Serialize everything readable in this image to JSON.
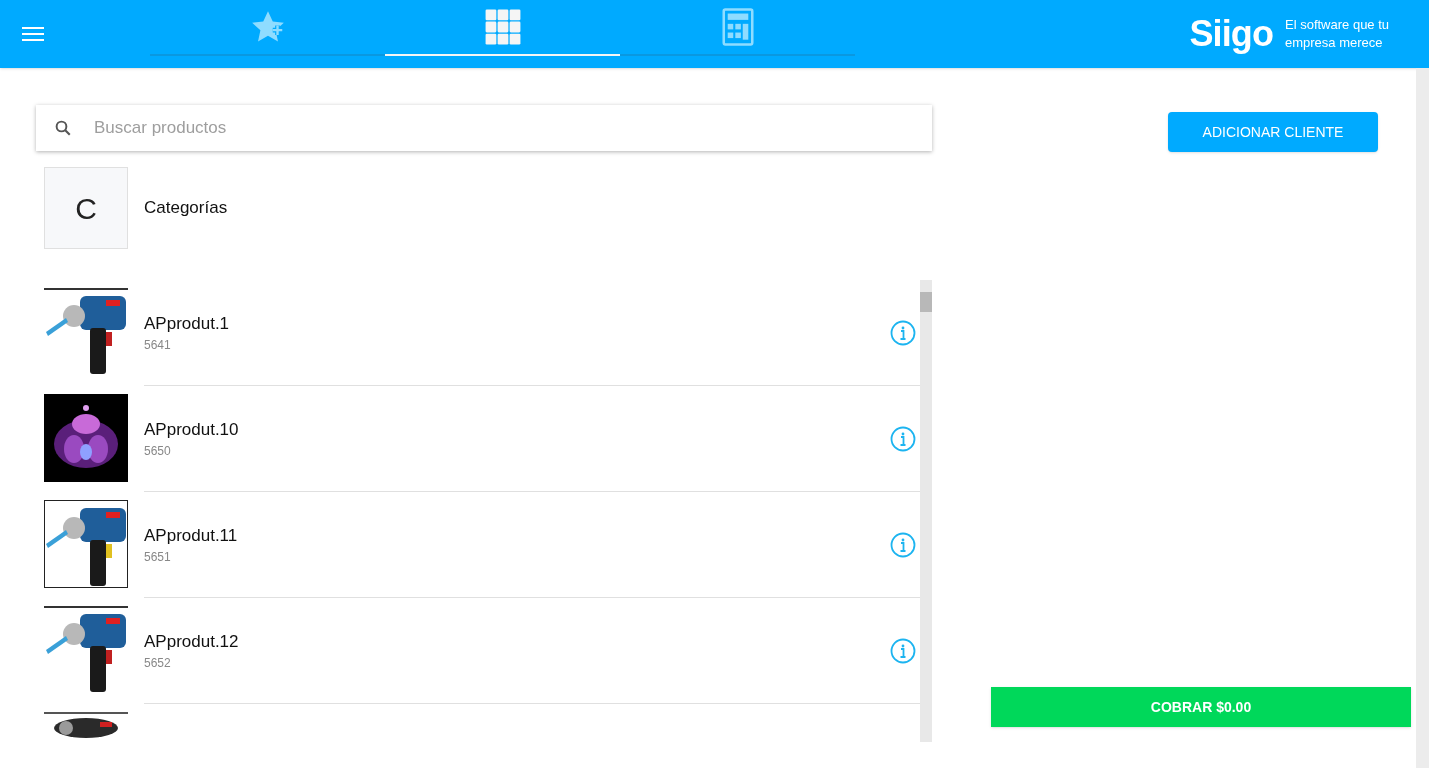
{
  "header": {
    "tabs": [
      {
        "kind": "star",
        "selected": false
      },
      {
        "kind": "grid",
        "selected": true
      },
      {
        "kind": "calculator",
        "selected": false
      }
    ],
    "logo": "Siigo",
    "slogan": "El software que tu empresa merece"
  },
  "search": {
    "placeholder": "Buscar productos"
  },
  "categories": {
    "letter": "C",
    "label": "Categorías"
  },
  "products": [
    {
      "kind": "product",
      "name": "APprodut.1",
      "code": "5641"
    },
    {
      "kind": "product",
      "name": "APprodut.10",
      "code": "5650"
    },
    {
      "kind": "product",
      "name": "APprodut.11",
      "code": "5651"
    },
    {
      "kind": "product",
      "name": "APprodut.12",
      "code": "5652"
    },
    {
      "kind": "image_only"
    }
  ],
  "add_client_button": "ADICIONAR CLIENTE",
  "charge_button": "COBRAR $0.00"
}
